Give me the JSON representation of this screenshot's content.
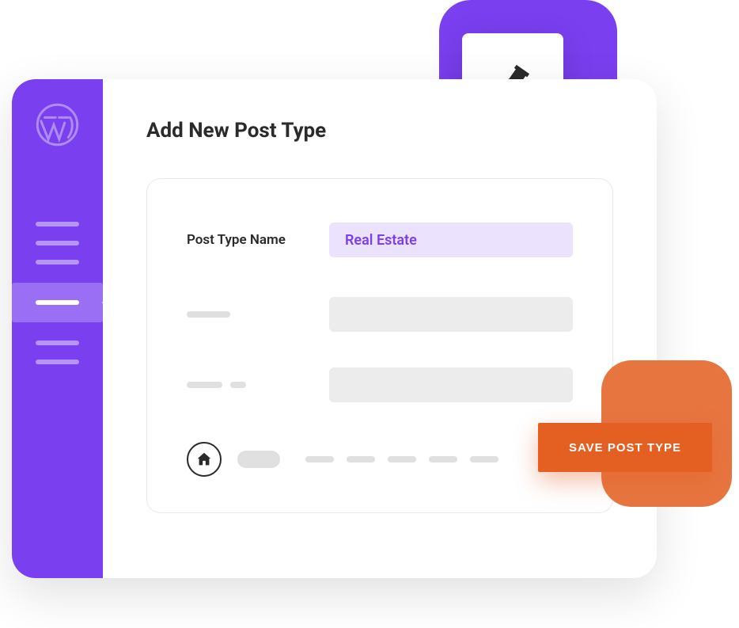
{
  "page": {
    "title": "Add New Post Type"
  },
  "form": {
    "fields": [
      {
        "label": "Post Type Name",
        "value": "Real Estate"
      }
    ]
  },
  "actions": {
    "save": "SAVE POST TYPE"
  }
}
